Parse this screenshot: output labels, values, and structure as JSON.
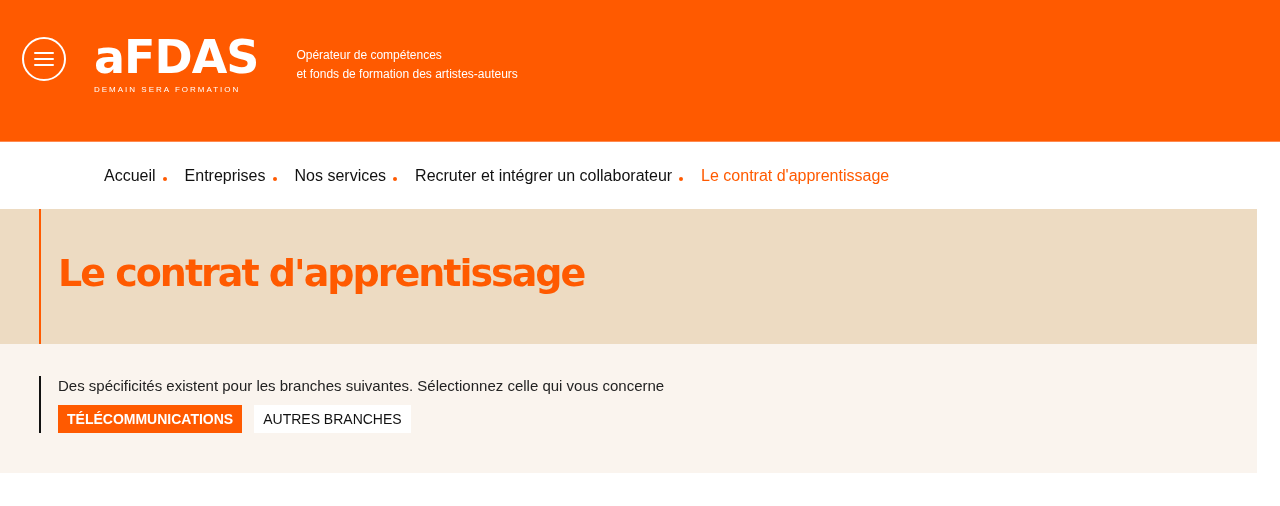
{
  "header": {
    "logo": "aFDAS",
    "logo_tagline": "DEMAIN SERA FORMATION",
    "tagline_lines": [
      "Opérateur de compétences",
      "et fonds de formation des artistes-auteurs"
    ]
  },
  "breadcrumb": [
    {
      "label": "Accueil",
      "current": false
    },
    {
      "label": "Entreprises",
      "current": false
    },
    {
      "label": "Nos services",
      "current": false
    },
    {
      "label": "Recruter et intégrer un collaborateur",
      "current": false
    },
    {
      "label": "Le contrat d'apprentissage",
      "current": true
    }
  ],
  "page_title": "Le contrat d'apprentissage",
  "branch_selector": {
    "prompt": "Des spécificités existent pour les branches suivantes. Sélectionnez celle qui vous concerne",
    "options": [
      {
        "label": "TÉLÉCOMMUNICATIONS",
        "selected": true
      },
      {
        "label": "AUTRES BRANCHES",
        "selected": false
      }
    ]
  }
}
